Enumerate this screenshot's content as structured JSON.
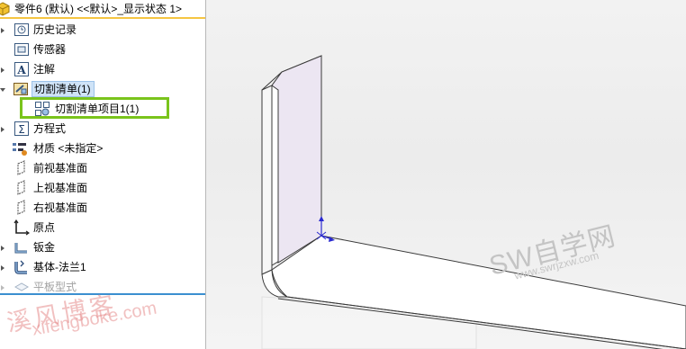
{
  "feature_tree": {
    "root_label": "零件6 (默认) <<默认>_显示状态 1>",
    "items": [
      {
        "label": "历史记录",
        "icon": "history-folder-icon"
      },
      {
        "label": "传感器",
        "icon": "sensor-folder-icon"
      },
      {
        "label": "注解",
        "icon": "annotation-icon"
      },
      {
        "label": "切割清单(1)",
        "icon": "cut-list-icon"
      },
      {
        "label": "切割清单项目1(1)",
        "icon": "cut-list-item-icon"
      },
      {
        "label": "方程式",
        "icon": "equation-icon"
      },
      {
        "label": "材质 <未指定>",
        "icon": "material-icon"
      },
      {
        "label": "前视基准面",
        "icon": "plane-icon"
      },
      {
        "label": "上视基准面",
        "icon": "plane-icon"
      },
      {
        "label": "右视基准面",
        "icon": "plane-icon"
      },
      {
        "label": "原点",
        "icon": "origin-icon"
      },
      {
        "label": "钣金",
        "icon": "sheet-metal-icon"
      },
      {
        "label": "基体-法兰1",
        "icon": "base-flange-icon"
      },
      {
        "label": "平板型式",
        "icon": "flat-pattern-icon"
      }
    ]
  },
  "watermarks": {
    "sw_logo": "SW自学网",
    "sw_url": "www.swrjzxw.com",
    "blog_name": "溪风博客",
    "blog_url": "xifengboke.com"
  },
  "colors": {
    "selection_highlight": "#7ac41c",
    "selected_row": "#cfe3f7",
    "header_underline": "#f5c542"
  }
}
